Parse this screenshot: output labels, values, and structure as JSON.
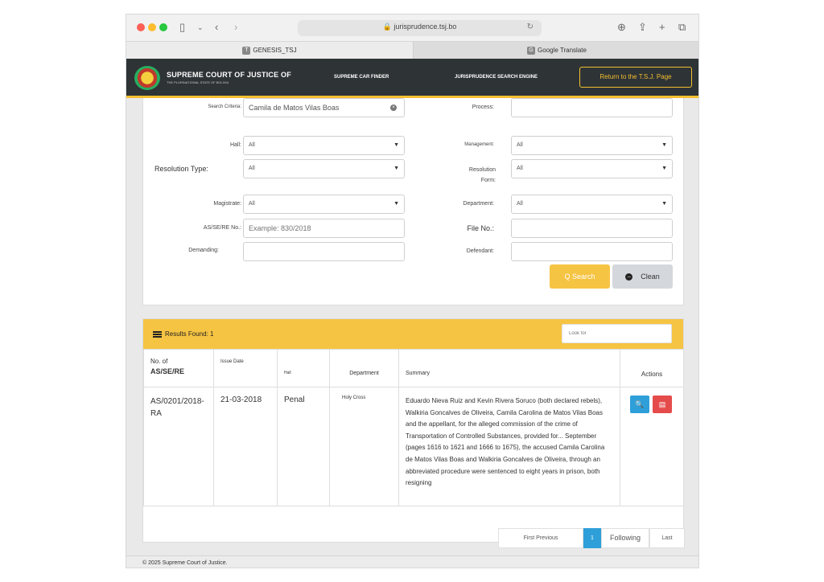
{
  "browser": {
    "url": "jurisprudence.tsj.bo",
    "tabs": [
      {
        "label": "GENESIS_TSJ",
        "favicon": "T"
      },
      {
        "label": "Google Translate",
        "favicon": "G"
      }
    ]
  },
  "header": {
    "court_name": "SUPREME COURT OF JUSTICE OF",
    "court_subtitle": "THE PLURINATIONAL STATE OF BOLIVIA",
    "nav": [
      "SUPREME CAR FINDER",
      "JURISPRUDENCE SEARCH ENGINE"
    ],
    "return_label": "Return to the T.S.J. Page"
  },
  "search": {
    "criteria_label": "Search Criteria:",
    "criteria_value": "Camila de Matos Vilas Boas",
    "process_label": "Process:",
    "hall_label": "Hall:",
    "hall_value": "All",
    "management_label": "Management:",
    "management_value": "All",
    "resolution_type_label": "Resolution Type:",
    "resolution_type_value": "All",
    "resolution_form_label": "Resolution Form:",
    "resolution_form_value": "All",
    "magistrate_label": "Magistrate:",
    "magistrate_value": "All",
    "department_label": "Department:",
    "department_value": "All",
    "as_label": "AS/SE/RE No.:",
    "as_placeholder": "Example: 830/2018",
    "file_label": "File No.:",
    "demanding_label": "Demanding:",
    "defendant_label": "Defendant:",
    "search_button": "Q Search",
    "clean_button": "Clean"
  },
  "results": {
    "found_label": "Results Found: 1",
    "look_for_placeholder": "Look for",
    "columns": {
      "no_top": "No. of",
      "no_bottom": "AS/SE/RE",
      "issue_date": "Issue Date",
      "hall": "Hall",
      "department": "Department",
      "summary": "Summary",
      "actions": "Actions"
    },
    "rows": [
      {
        "no": "AS/0201/2018-RA",
        "issue_date": "21-03-2018",
        "hall": "Penal",
        "department": "Holy Cross",
        "summary": "Eduardo Nieva Ruiz and Kevin Rivera Soruco (both declared rebels), Walkiria Goncalves de Oliveira, Camila Carolina de Matos Vilas Boas and the appellant, for the alleged commission of the crime of Transportation of Controlled Substances, provided for... September (pages 1616 to 1621 and 1666 to 1675), the accused Camila Carolina de Matos Vilas Boas and Walkiria Goncalves de Oliveira, through an abbreviated procedure were sentenced to eight years in prison, both resigning"
      }
    ],
    "pager": {
      "first_previous": "First Previous",
      "current": "1",
      "following": "Following",
      "last": "Last"
    }
  },
  "footer": "© 2025 Supreme Court of Justice."
}
